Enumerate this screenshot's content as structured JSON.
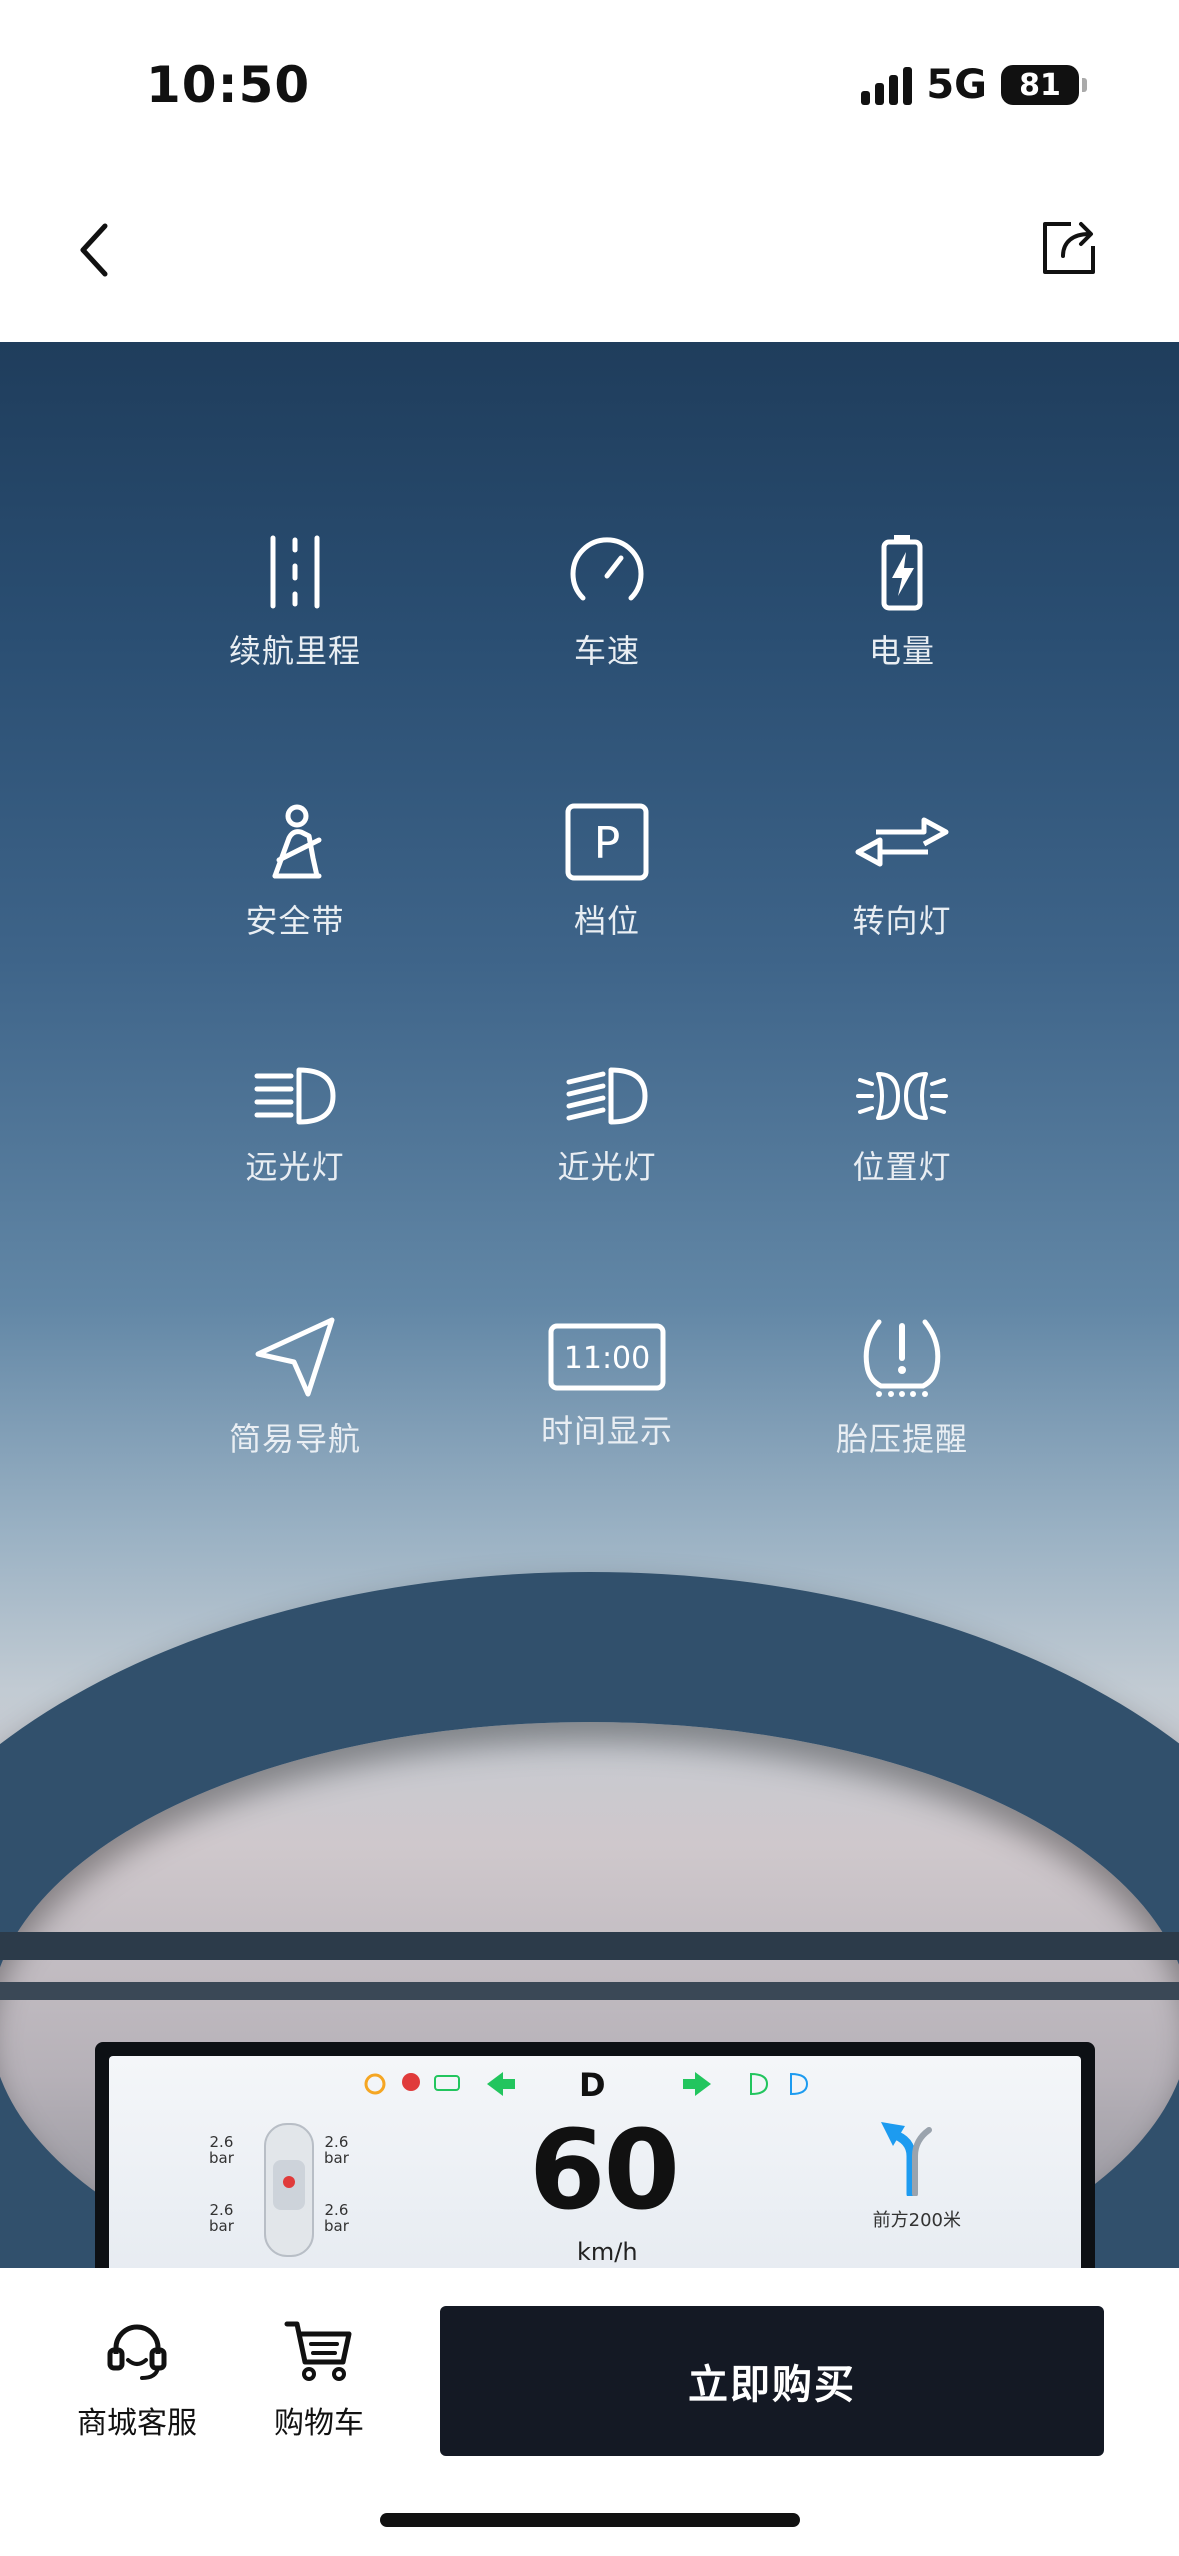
{
  "status_bar": {
    "time": "10:50",
    "network": "5G",
    "battery": "81"
  },
  "features": [
    {
      "label": "续航里程",
      "icon": "range-icon"
    },
    {
      "label": "车速",
      "icon": "speedometer-icon"
    },
    {
      "label": "电量",
      "icon": "battery-charge-icon"
    },
    {
      "label": "安全带",
      "icon": "seatbelt-icon"
    },
    {
      "label": "档位",
      "icon": "park-gear-icon"
    },
    {
      "label": "转向灯",
      "icon": "turn-signal-icon"
    },
    {
      "label": "远光灯",
      "icon": "high-beam-icon"
    },
    {
      "label": "近光灯",
      "icon": "low-beam-icon"
    },
    {
      "label": "位置灯",
      "icon": "position-light-icon"
    },
    {
      "label": "简易导航",
      "icon": "navigation-icon"
    },
    {
      "label": "时间显示",
      "icon": "clock-display-icon",
      "icon_text": "11:00"
    },
    {
      "label": "胎压提醒",
      "icon": "tire-pressure-icon"
    }
  ],
  "dashboard": {
    "gear": "D",
    "speed": "60",
    "unit": "km/h",
    "nav_distance": "前方200米",
    "tyres": [
      "2.6",
      "bar"
    ]
  },
  "bottom_bar": {
    "service_label": "商城客服",
    "cart_label": "购物车",
    "buy_label": "立即购买"
  },
  "colors": {
    "buy_button": "#141924",
    "indicator_green": "#22c55e",
    "indicator_blue": "#1d9bf0"
  }
}
